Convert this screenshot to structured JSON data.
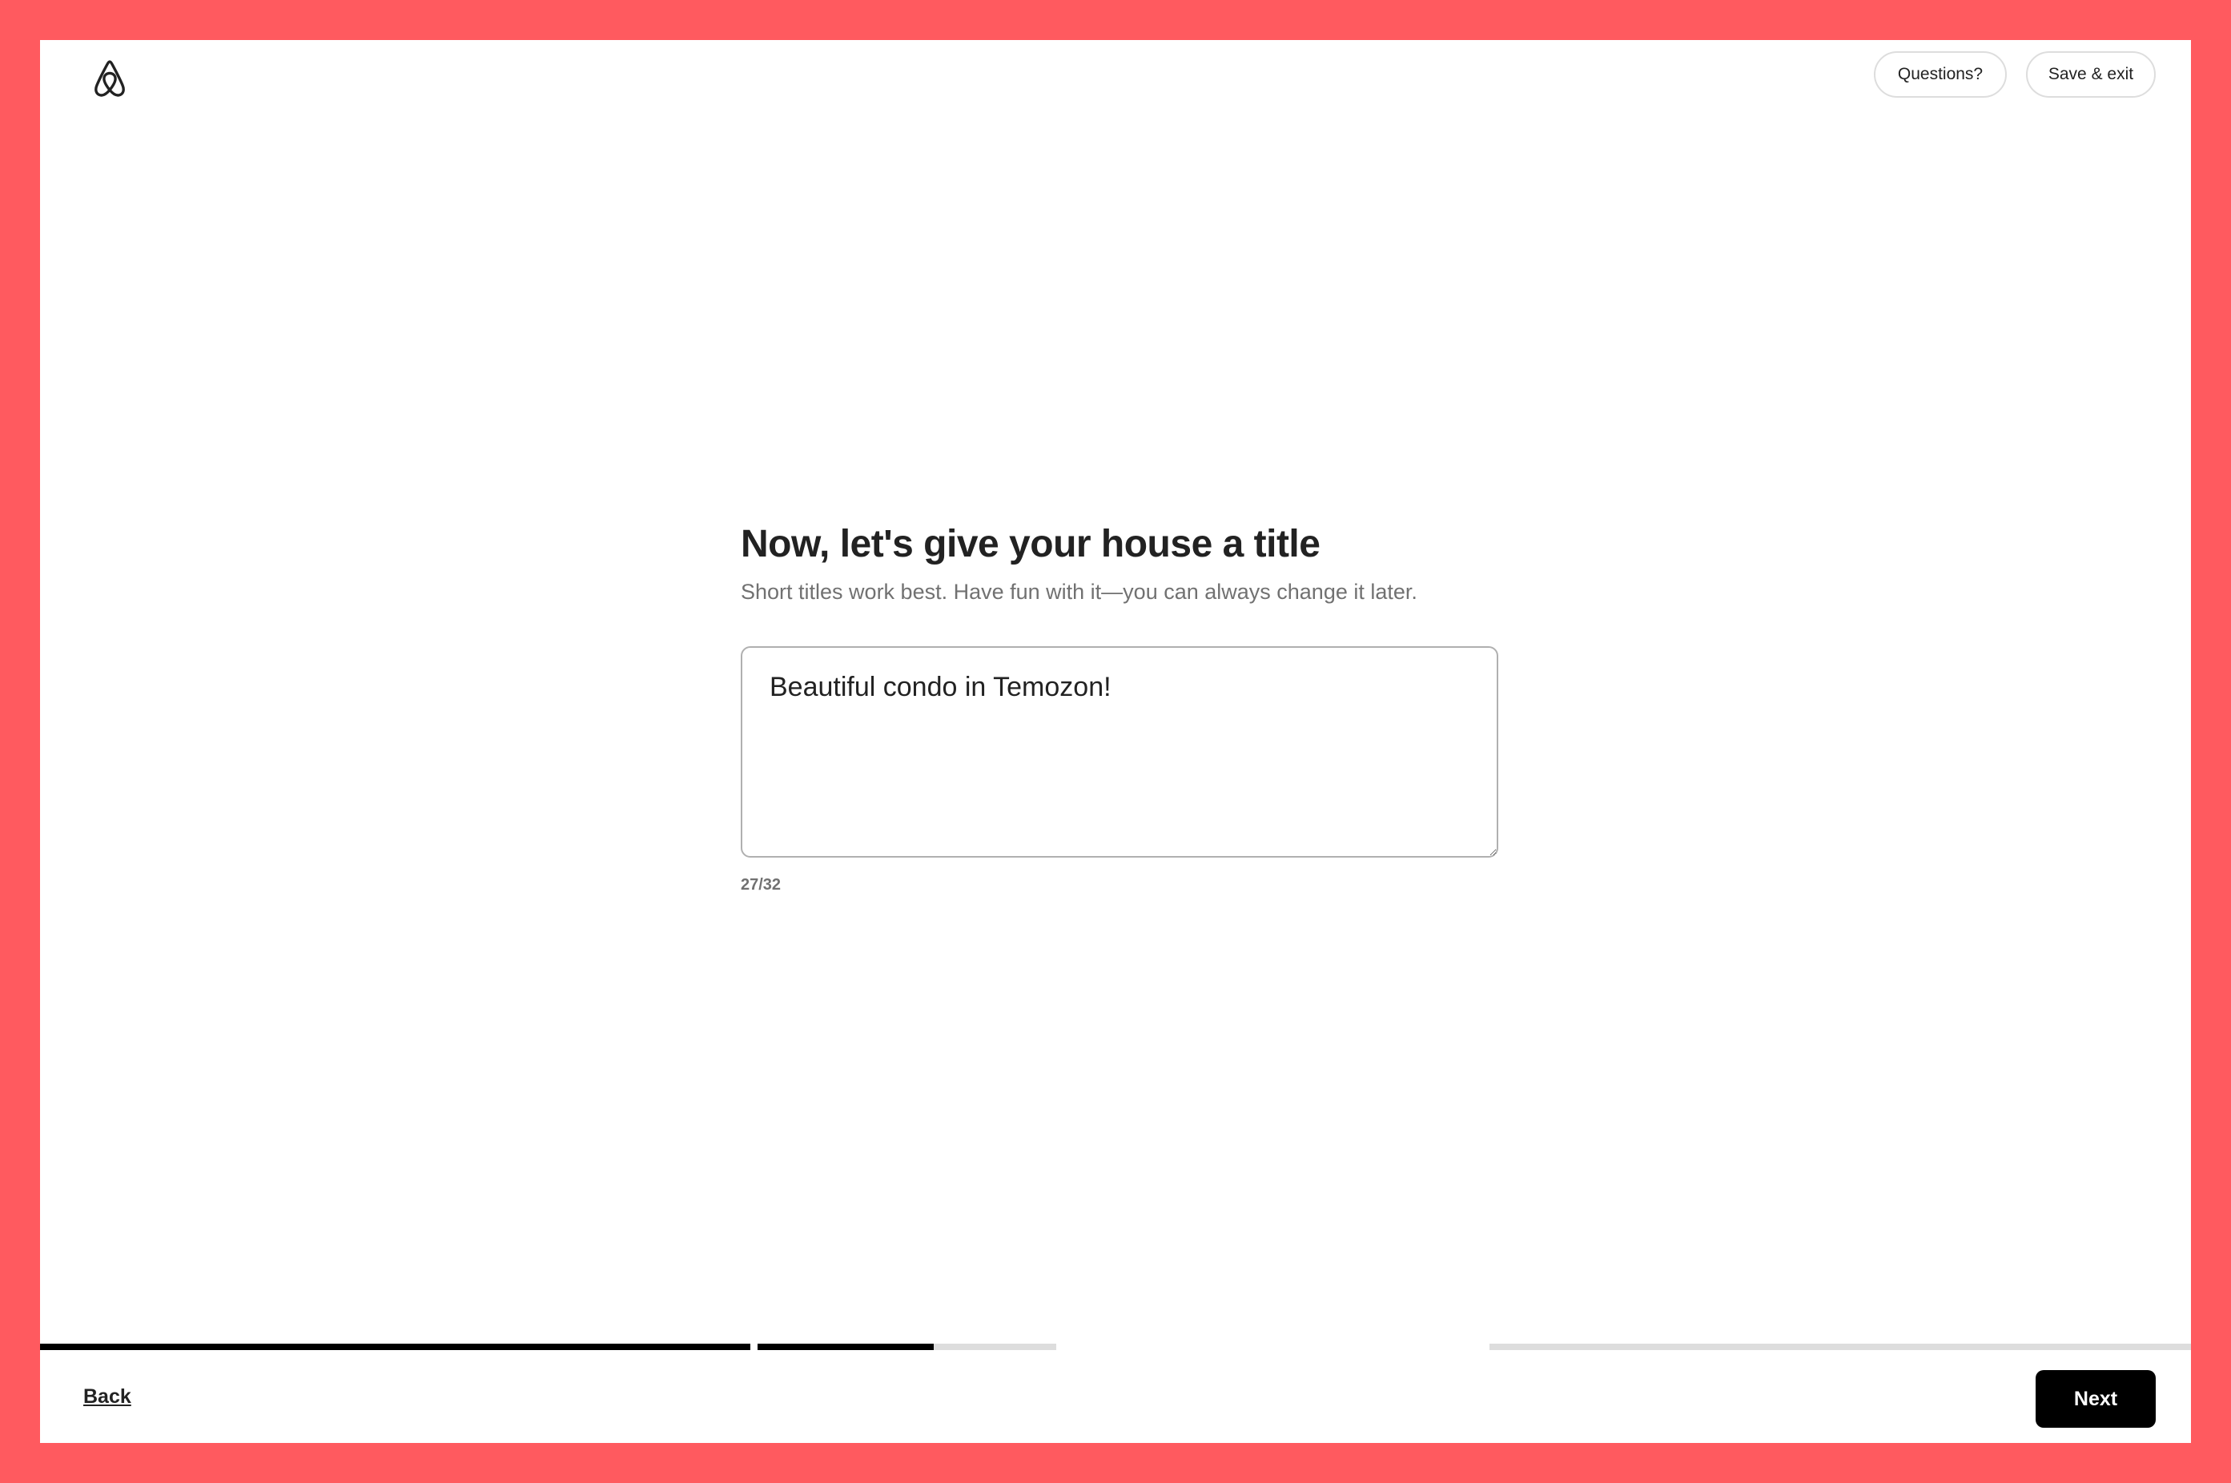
{
  "header": {
    "logo_icon": "airbnb-logo-icon",
    "questions_label": "Questions?",
    "save_exit_label": "Save & exit"
  },
  "main": {
    "title": "Now, let's give your house a title",
    "subtitle": "Short titles work best. Have fun with it—you can always change it later.",
    "title_input_value": "Beautiful condo in Temozon!",
    "char_count": "27/32"
  },
  "progress": {
    "steps": [
      {
        "fraction": 1.0
      },
      {
        "fraction": 0.59
      },
      {
        "fraction": 0.0
      }
    ]
  },
  "footer": {
    "back_label": "Back",
    "next_label": "Next"
  },
  "colors": {
    "frame_border": "#ff5a5f",
    "text_primary": "#222222",
    "text_secondary": "#717171",
    "progress_done": "#000000",
    "progress_todo": "#dddddd"
  }
}
